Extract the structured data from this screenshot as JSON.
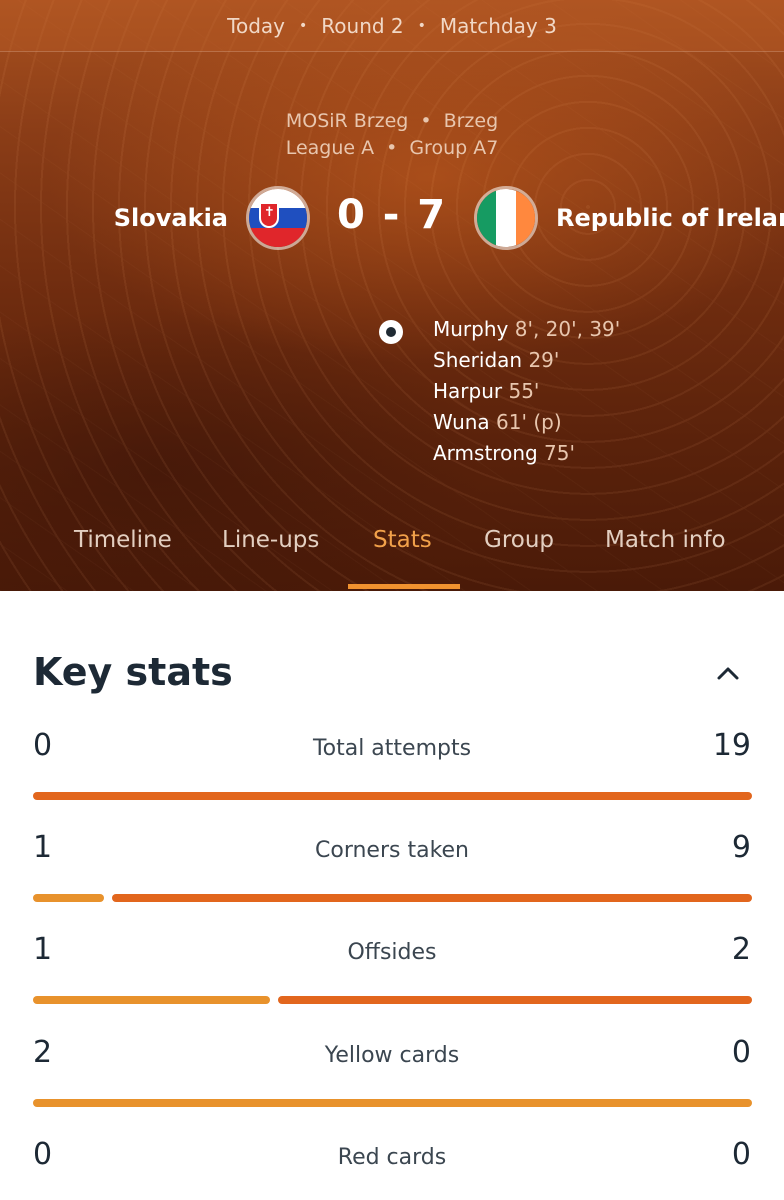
{
  "header": {
    "date": "Today",
    "round": "Round 2",
    "matchday": "Matchday 3",
    "stadium": "MOSiR Brzeg",
    "city": "Brzeg",
    "league": "League A",
    "group": "Group A7"
  },
  "match": {
    "home_team": "Slovakia",
    "away_team": "Republic of Ireland",
    "home_score": "0",
    "away_score": "7",
    "score": "0 - 7",
    "home_flag": "slovakia-flag",
    "away_flag": "ireland-flag",
    "scorers": [
      {
        "name": "Murphy",
        "minutes": "8', 20', 39'"
      },
      {
        "name": "Sheridan",
        "minutes": "29'"
      },
      {
        "name": "Harpur",
        "minutes": "55'"
      },
      {
        "name": "Wuna",
        "minutes": "61' (p)"
      },
      {
        "name": "Armstrong",
        "minutes": "75'"
      }
    ]
  },
  "tabs": [
    {
      "label": "Timeline"
    },
    {
      "label": "Line-ups"
    },
    {
      "label": "Stats",
      "active": true
    },
    {
      "label": "Group"
    },
    {
      "label": "Match info"
    }
  ],
  "key_stats": {
    "title": "Key stats",
    "rows": [
      {
        "label": "Total attempts",
        "home": "0",
        "away": "19"
      },
      {
        "label": "Corners taken",
        "home": "1",
        "away": "9"
      },
      {
        "label": "Offsides",
        "home": "1",
        "away": "2"
      },
      {
        "label": "Yellow cards",
        "home": "2",
        "away": "0"
      },
      {
        "label": "Red cards",
        "home": "0",
        "away": "0"
      }
    ]
  },
  "colors": {
    "accent": "#f0922f",
    "home_bar": "#e8922c",
    "away_bar": "#e2661d"
  }
}
